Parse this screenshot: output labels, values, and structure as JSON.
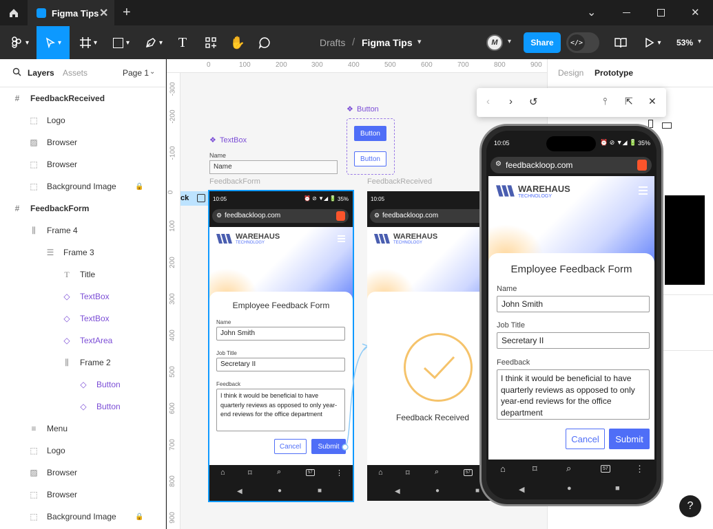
{
  "titlebar": {
    "tab_title": "Figma Tips"
  },
  "toolbar": {
    "breadcrumb_parent": "Drafts",
    "breadcrumb_sep": "/",
    "file_name": "Figma Tips",
    "share_label": "Share",
    "zoom": "53%",
    "avatar_initials": "M"
  },
  "left_panel": {
    "tab_layers": "Layers",
    "tab_assets": "Assets",
    "page_selector": "Page 1",
    "layers": [
      {
        "label": "FeedbackReceived"
      },
      {
        "label": "Logo"
      },
      {
        "label": "Browser"
      },
      {
        "label": "Browser"
      },
      {
        "label": "Background Image"
      },
      {
        "label": "FeedbackForm"
      },
      {
        "label": "Frame 4"
      },
      {
        "label": "Frame 3"
      },
      {
        "label": "Title"
      },
      {
        "label": "TextBox"
      },
      {
        "label": "TextBox"
      },
      {
        "label": "TextArea"
      },
      {
        "label": "Frame 2"
      },
      {
        "label": "Button"
      },
      {
        "label": "Button"
      },
      {
        "label": "Menu"
      },
      {
        "label": "Logo"
      },
      {
        "label": "Browser"
      },
      {
        "label": "Browser"
      },
      {
        "label": "Background Image"
      }
    ]
  },
  "ruler": {
    "top": [
      "0",
      "100",
      "200",
      "300",
      "400",
      "500",
      "600",
      "700",
      "800",
      "900"
    ],
    "left": [
      "-300",
      "-200",
      "-100",
      "0",
      "100",
      "200",
      "300",
      "400",
      "500",
      "600",
      "700",
      "800",
      "900"
    ]
  },
  "canvas": {
    "textbox_component": "TextBox",
    "textbox_label": "Name",
    "textbox_value": "Name",
    "button_component": "Button",
    "button_primary": "Button",
    "button_secondary": "Button",
    "frame1_label": "FeedbackForm",
    "frame2_label": "FeedbackReceived",
    "selection_fragment": "ck"
  },
  "phone": {
    "time": "10:05",
    "battery": "35%",
    "url": "feedbackloop.com",
    "brand_name": "WAREHAUS",
    "brand_sub": "TECHNOLOGY",
    "form_title": "Employee Feedback Form",
    "name_label": "Name",
    "name_value": "John Smith",
    "job_label": "Job Title",
    "job_value": "Secretary II",
    "feedback_label": "Feedback",
    "feedback_value": "I think it would be beneficial to have quarterly reviews as opposed to only year-end reviews for the office department",
    "cancel_label": "Cancel",
    "submit_label": "Submit",
    "received_label": "Feedback Received",
    "tab_count": "57"
  },
  "right_panel": {
    "tab_design": "Design",
    "tab_prototype": "Prototype"
  },
  "colors": {
    "accent": "#0d99ff",
    "primary_button": "#4f6ef7",
    "component": "#7b4dd6",
    "check": "#f5c36b"
  }
}
